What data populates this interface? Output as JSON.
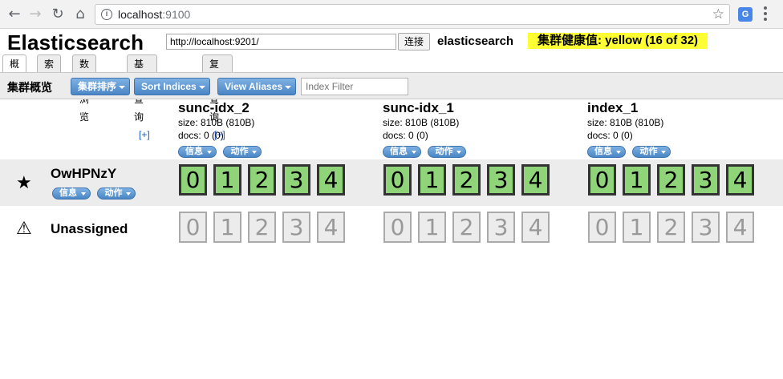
{
  "browser": {
    "url_host": "localhost",
    "url_port": ":9100",
    "back_icon": "arrow-left-icon",
    "forward_icon": "arrow-right-icon",
    "reload_icon": "reload-icon",
    "home_icon": "home-icon",
    "bookmark_icon": "star-icon",
    "extension_icon": "translate-icon",
    "extension_glyph": "G"
  },
  "header": {
    "title": "Elasticsearch",
    "cluster_url": "http://localhost:9201/",
    "connect_label": "连接",
    "cluster_name": "elasticsearch",
    "health": "集群健康值: yellow (16 of 32)",
    "health_color": "#ffff33"
  },
  "tabs": [
    {
      "label": "概览",
      "plus": ""
    },
    {
      "label": "索引",
      "plus": ""
    },
    {
      "label": "数据浏览",
      "plus": ""
    },
    {
      "label": "基本查询",
      "plus": "[+]"
    },
    {
      "label": "复合查询",
      "plus": "[+]"
    }
  ],
  "toolbar": {
    "title": "集群概览",
    "sort_cluster": "集群排序",
    "sort_indices": "Sort Indices",
    "view_aliases": "View Aliases",
    "filter_placeholder": "Index Filter"
  },
  "indices": [
    {
      "name": "sunc-idx_2",
      "size": "size: 810B (810B)",
      "docs": "docs: 0 (0)",
      "info": "信息",
      "action": "动作"
    },
    {
      "name": "sunc-idx_1",
      "size": "size: 810B (810B)",
      "docs": "docs: 0 (0)",
      "info": "信息",
      "action": "动作"
    },
    {
      "name": "index_1",
      "size": "size: 810B (810B)",
      "docs": "docs: 0 (0)",
      "info": "信息",
      "action": "动作"
    }
  ],
  "node": {
    "name": "OwHPNzY",
    "icon": "star-icon",
    "info": "信息",
    "action": "动作",
    "shards": [
      "0",
      "1",
      "2",
      "3",
      "4"
    ]
  },
  "unassigned": {
    "label": "Unassigned",
    "icon": "warning-icon",
    "shards": [
      "0",
      "1",
      "2",
      "3",
      "4"
    ]
  },
  "colors": {
    "shard_started": "#90d47a",
    "shard_unassigned": "#ececec",
    "button_blue": "#4a86c5"
  }
}
